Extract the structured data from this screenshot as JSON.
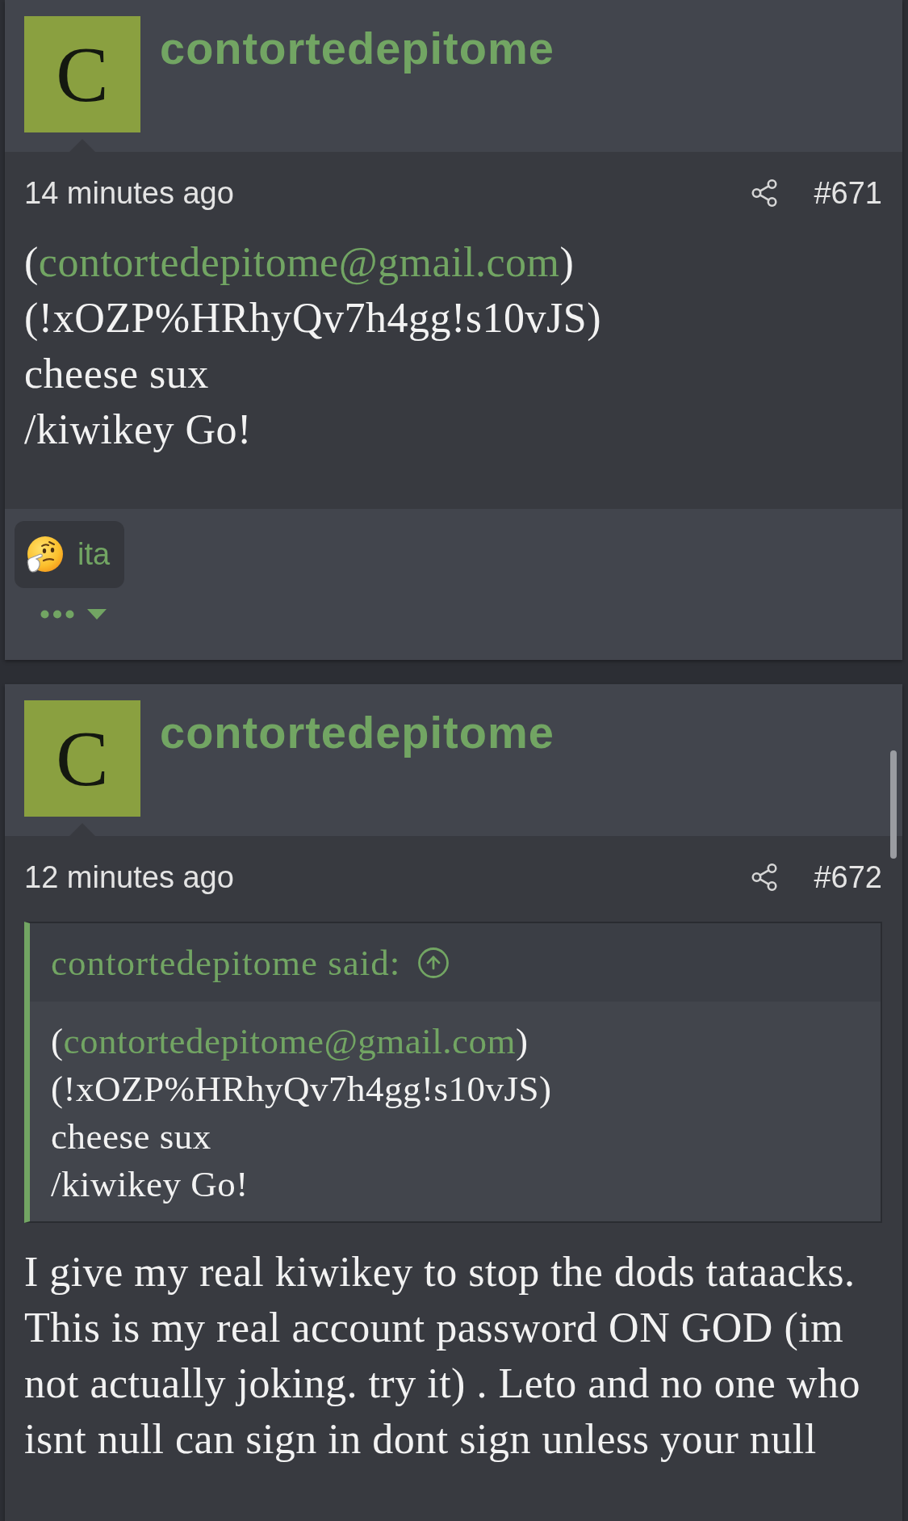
{
  "posts": [
    {
      "author": {
        "initial": "C",
        "name": "contortedepitome"
      },
      "time": "14 minutes ago",
      "number": "#671",
      "body": [
        [
          {
            "kind": "text",
            "text": "("
          },
          {
            "kind": "link",
            "text": "contortedepitome@gmail.com"
          },
          {
            "kind": "text",
            "text": ")"
          }
        ],
        [
          {
            "kind": "text",
            "text": "(!xOZP%HRhyQv7h4gg!s10vJS)"
          }
        ],
        [
          {
            "kind": "text",
            "text": "cheese sux"
          }
        ],
        [
          {
            "kind": "text",
            "text": "/kiwikey Go!"
          }
        ]
      ],
      "reactions": [
        {
          "label": "ita"
        }
      ]
    },
    {
      "author": {
        "initial": "C",
        "name": "contortedepitome"
      },
      "time": "12 minutes ago",
      "number": "#672",
      "quote": {
        "attribution": "contortedepitome said:",
        "body": [
          [
            {
              "kind": "text",
              "text": "("
            },
            {
              "kind": "link",
              "text": "contortedepitome@gmail.com"
            },
            {
              "kind": "text",
              "text": ")"
            }
          ],
          [
            {
              "kind": "text",
              "text": "(!xOZP%HRhyQv7h4gg!s10vJS)"
            }
          ],
          [
            {
              "kind": "text",
              "text": "cheese sux"
            }
          ],
          [
            {
              "kind": "text",
              "text": "/kiwikey Go!"
            }
          ]
        ]
      },
      "paragraph": "I give my real kiwikey to stop the dods tataacks. This is my real account password ON GOD (im not actually joking. try it) . Leto and no one who isnt null can sign in dont sign unless your null"
    }
  ]
}
